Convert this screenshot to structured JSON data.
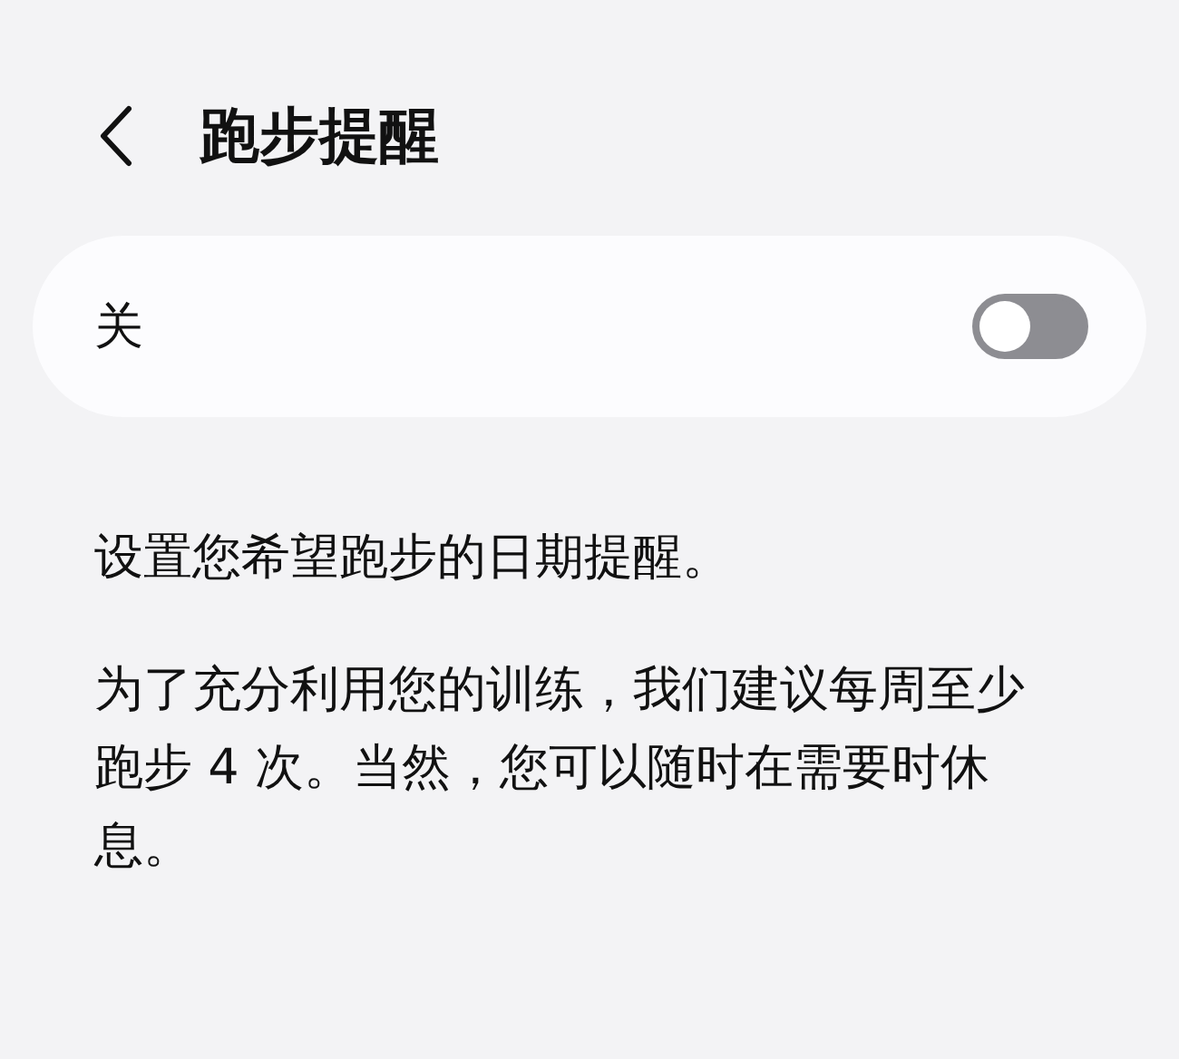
{
  "header": {
    "title": "跑步提醒"
  },
  "toggle_card": {
    "label": "关",
    "on": false
  },
  "paragraphs": [
    "设置您希望跑步的日期提醒。",
    "为了充分利用您的训练，我们建议每周至少跑步 4 次。当然，您可以随时在需要时休息。"
  ]
}
